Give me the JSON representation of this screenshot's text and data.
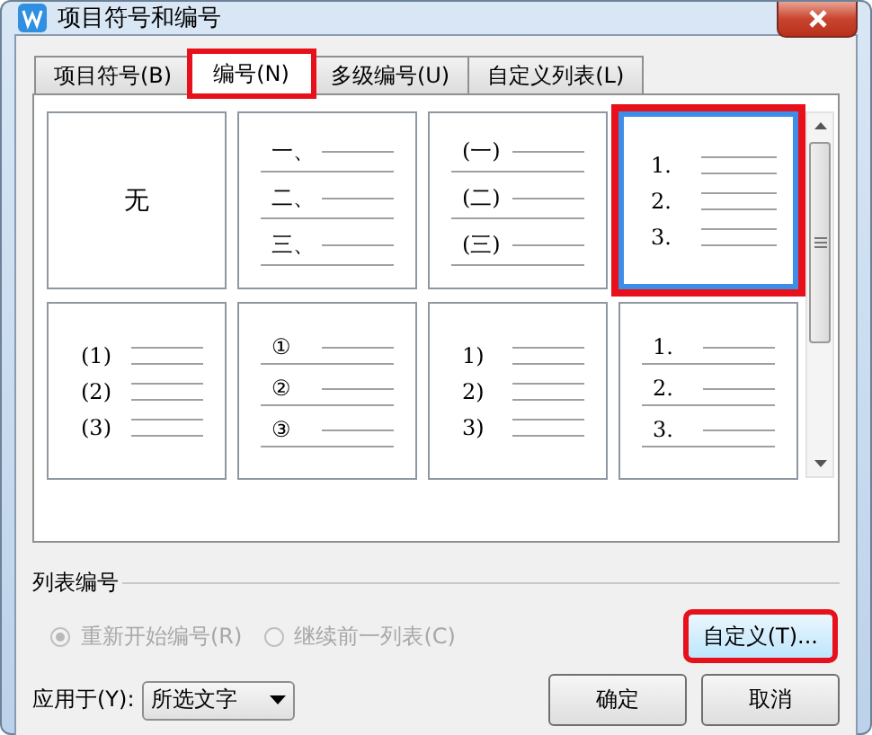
{
  "window": {
    "title": "项目符号和编号"
  },
  "tabs": [
    {
      "label": "项目符号(B)",
      "selected": false,
      "highlighted": false
    },
    {
      "label": "编号(N)",
      "selected": true,
      "highlighted": true
    },
    {
      "label": "多级编号(U)",
      "selected": false,
      "highlighted": false
    },
    {
      "label": "自定义列表(L)",
      "selected": false,
      "highlighted": false
    }
  ],
  "styles": [
    {
      "kind": "none",
      "label": "无",
      "selected": false,
      "highlighted": false
    },
    {
      "kind": "full",
      "numbers": [
        "一、",
        "二、",
        "三、"
      ],
      "selected": false,
      "highlighted": false
    },
    {
      "kind": "full",
      "numbers": [
        "(一)",
        "(二)",
        "(三)"
      ],
      "selected": false,
      "highlighted": false
    },
    {
      "kind": "split",
      "numbers": [
        "1.",
        "2.",
        "3."
      ],
      "selected": true,
      "highlighted": true
    },
    {
      "kind": "split",
      "numbers": [
        "(1)",
        "(2)",
        "(3)"
      ],
      "selected": false,
      "highlighted": false
    },
    {
      "kind": "full",
      "numbers": [
        "①",
        "②",
        "③"
      ],
      "selected": false,
      "highlighted": false
    },
    {
      "kind": "split",
      "numbers": [
        "1)",
        "2)",
        "3)"
      ],
      "selected": false,
      "highlighted": false
    },
    {
      "kind": "full",
      "numbers": [
        "1.",
        "2.",
        "3."
      ],
      "selected": false,
      "highlighted": false
    }
  ],
  "list_numbering": {
    "title": "列表编号",
    "options": [
      {
        "label": "重新开始编号(R)",
        "checked": true,
        "disabled": true
      },
      {
        "label": "继续前一列表(C)",
        "checked": false,
        "disabled": true
      }
    ],
    "customize_button": {
      "label": "自定义(T)...",
      "highlighted": true
    }
  },
  "apply_to": {
    "label": "应用于(Y):",
    "value": "所选文字"
  },
  "buttons": [
    "确定",
    "取消"
  ]
}
